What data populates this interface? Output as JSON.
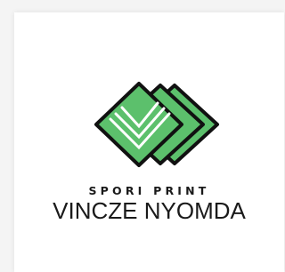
{
  "logo": {
    "tagline": "SPORI PRINT",
    "name": "VINCZE NYOMDA",
    "icon": "stacked-green-diamond-book-icon",
    "colors": {
      "green": "#5cc06c",
      "outline": "#111111",
      "accent": "#ffffff",
      "text": "#1a1a1a",
      "background": "#ffffff"
    }
  }
}
